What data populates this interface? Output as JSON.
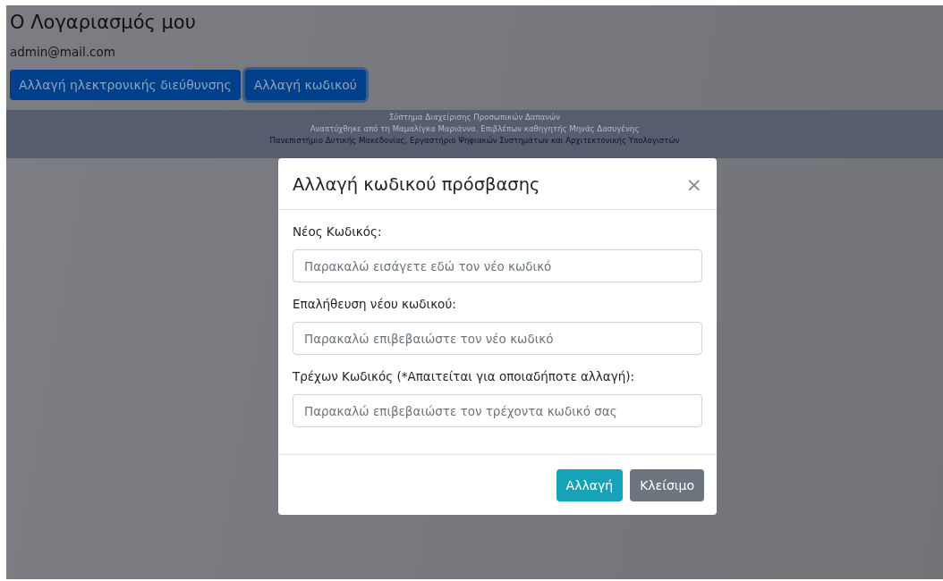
{
  "page": {
    "title": "Ο Λογαριασμός μου",
    "email": "admin@mail.com",
    "buttons": [
      {
        "label": "Αλλαγή ηλεκτρονικής διεύθυνσης",
        "focused": false
      },
      {
        "label": "Αλλαγή κωδικού",
        "focused": true
      }
    ]
  },
  "footer": {
    "lines": [
      "Σύστημα Διαχείρισης Προσωπικών Δαπανών",
      "Αναπτύχθηκε από τη Μαμαλίγκα Μαριάννα. Επιβλέπων καθηγητής Μηνάς Δασυγένης",
      "Πανεπιστήμιο Δυτικής Μακεδονίας, Εργαστήριο Ψηφιακών Συστημάτων και Αρχιτεκτονικής Υπολογιστών"
    ]
  },
  "modal": {
    "title": "Αλλαγή κωδικού πρόσβασης",
    "close": "×",
    "fields": [
      {
        "label": "Νέος Κωδικός:",
        "placeholder": "Παρακαλώ εισάγετε εδώ τον νέο κωδικό"
      },
      {
        "label": "Επαλήθευση νέου κωδικού:",
        "placeholder": "Παρακαλώ επιβεβαιώστε τον νέο κωδικό"
      },
      {
        "label": "Τρέχων Κωδικός (*Απαιτείται για οποιαδήποτε αλλαγή):",
        "placeholder": "Παρακαλώ επιβεβαιώστε τον τρέχοντα κωδικό σας"
      }
    ],
    "buttons": [
      {
        "label": "Αλλαγή",
        "kind": "primary"
      },
      {
        "label": "Κλείσιμο",
        "kind": "secondary"
      }
    ]
  }
}
